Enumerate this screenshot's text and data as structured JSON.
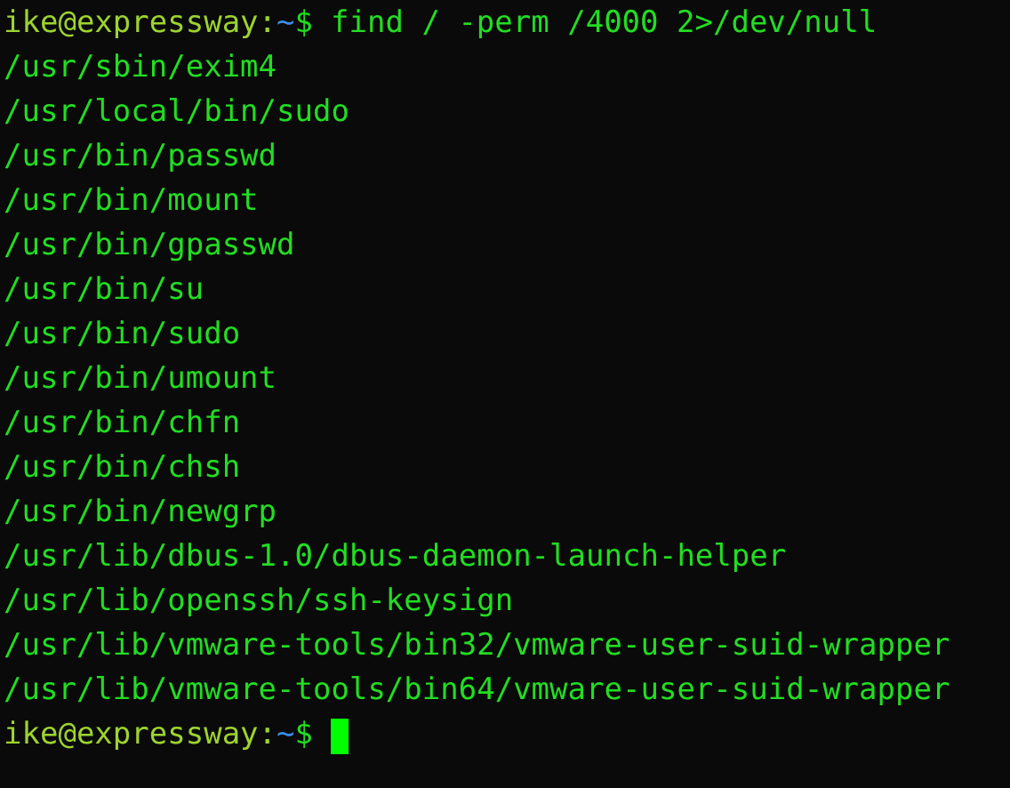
{
  "lines": [
    {
      "kind": "prompt",
      "user_host": "ike@expressway",
      "separator": ":",
      "path": "~",
      "symbol": "$",
      "command": "find / -perm /4000 2>/dev/null"
    },
    {
      "kind": "output",
      "text": "/usr/sbin/exim4"
    },
    {
      "kind": "output",
      "text": "/usr/local/bin/sudo"
    },
    {
      "kind": "output",
      "text": "/usr/bin/passwd"
    },
    {
      "kind": "output",
      "text": "/usr/bin/mount"
    },
    {
      "kind": "output",
      "text": "/usr/bin/gpasswd"
    },
    {
      "kind": "output",
      "text": "/usr/bin/su"
    },
    {
      "kind": "output",
      "text": "/usr/bin/sudo"
    },
    {
      "kind": "output",
      "text": "/usr/bin/umount"
    },
    {
      "kind": "output",
      "text": "/usr/bin/chfn"
    },
    {
      "kind": "output",
      "text": "/usr/bin/chsh"
    },
    {
      "kind": "output",
      "text": "/usr/bin/newgrp"
    },
    {
      "kind": "output",
      "text": "/usr/lib/dbus-1.0/dbus-daemon-launch-helper"
    },
    {
      "kind": "output",
      "text": "/usr/lib/openssh/ssh-keysign"
    },
    {
      "kind": "output",
      "text": "/usr/lib/vmware-tools/bin32/vmware-user-suid-wrapper"
    },
    {
      "kind": "output",
      "text": "/usr/lib/vmware-tools/bin64/vmware-user-suid-wrapper"
    },
    {
      "kind": "prompt",
      "user_host": "ike@expressway",
      "separator": ":",
      "path": "~",
      "symbol": "$",
      "cursor": true
    }
  ]
}
